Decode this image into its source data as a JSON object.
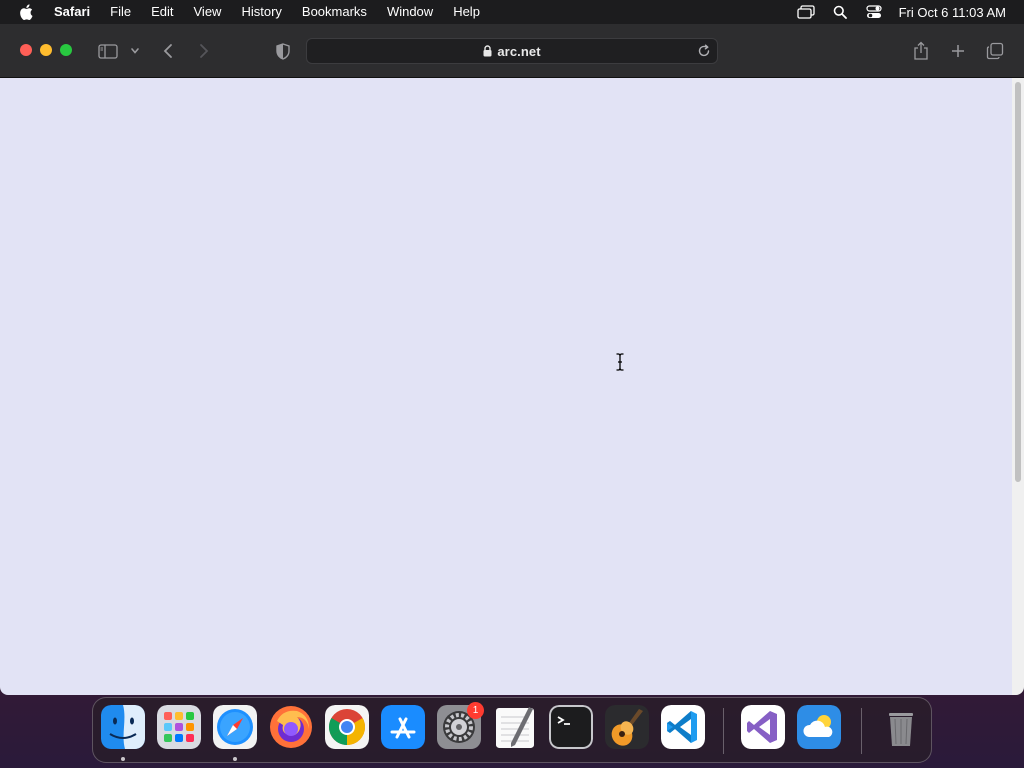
{
  "menubar": {
    "app_name": "Safari",
    "items": [
      "File",
      "Edit",
      "View",
      "History",
      "Bookmarks",
      "Window",
      "Help"
    ],
    "clock": "Fri Oct 6  11:03 AM",
    "status_icons": [
      "screen-mirroring-icon",
      "spotlight-search-icon",
      "control-center-icon"
    ]
  },
  "browser": {
    "address": "arc.net",
    "page_background": "#e2e3f5"
  },
  "dock": {
    "apps": [
      {
        "name": "Finder",
        "running": true
      },
      {
        "name": "Launchpad",
        "running": false
      },
      {
        "name": "Safari",
        "running": true
      },
      {
        "name": "Firefox",
        "running": false
      },
      {
        "name": "Google Chrome",
        "running": false
      },
      {
        "name": "App Store",
        "running": false
      },
      {
        "name": "System Settings",
        "running": false,
        "badge": "1"
      },
      {
        "name": "TextEdit",
        "running": false
      },
      {
        "name": "Terminal",
        "running": false
      },
      {
        "name": "GarageBand",
        "running": false
      },
      {
        "name": "Visual Studio Code",
        "running": false
      },
      {
        "name": "Visual Studio",
        "running": false
      },
      {
        "name": "Weather",
        "running": false
      },
      {
        "name": "Trash",
        "running": false
      }
    ]
  },
  "colors": {
    "menubar_bg": "#1c1c1e",
    "toolbar_bg": "#2d2d2f",
    "close": "#fe5f57",
    "minimize": "#febc2e",
    "maximize": "#28c840",
    "badge": "#ff3b30"
  }
}
